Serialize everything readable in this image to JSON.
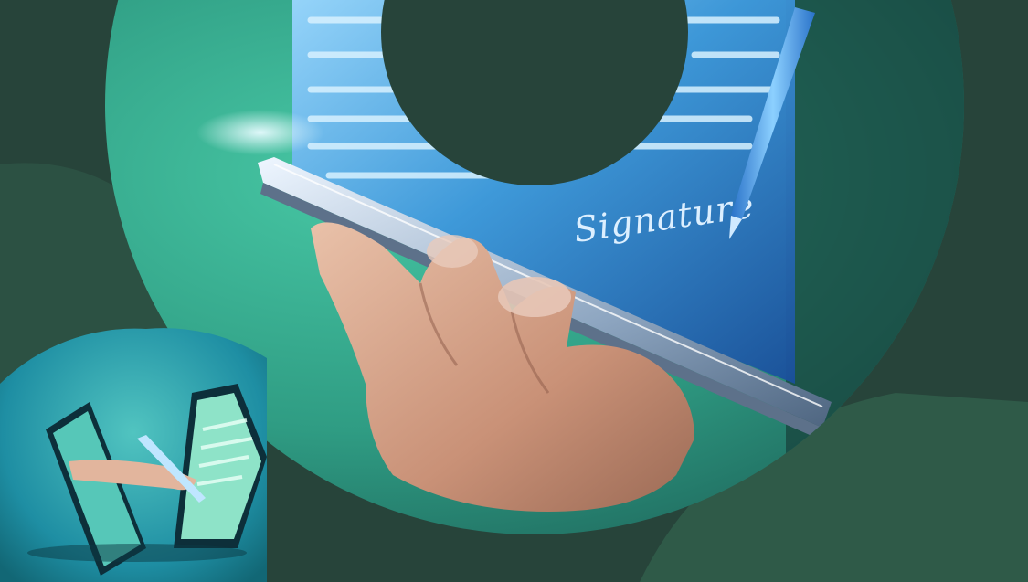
{
  "image": {
    "description_label": "signature",
    "signature_text": "Signature",
    "colors": {
      "background_dark": "#27443a",
      "band_mid": "#2f5a48",
      "teal_light": "#3fb598",
      "teal_deep": "#1f6f66",
      "document_blue": "#3a9be0",
      "document_glow": "#bfe8ff",
      "skin": "#d7a78f",
      "phone_edge": "#9fb3c8",
      "pen_blue": "#4aa8ff"
    }
  }
}
